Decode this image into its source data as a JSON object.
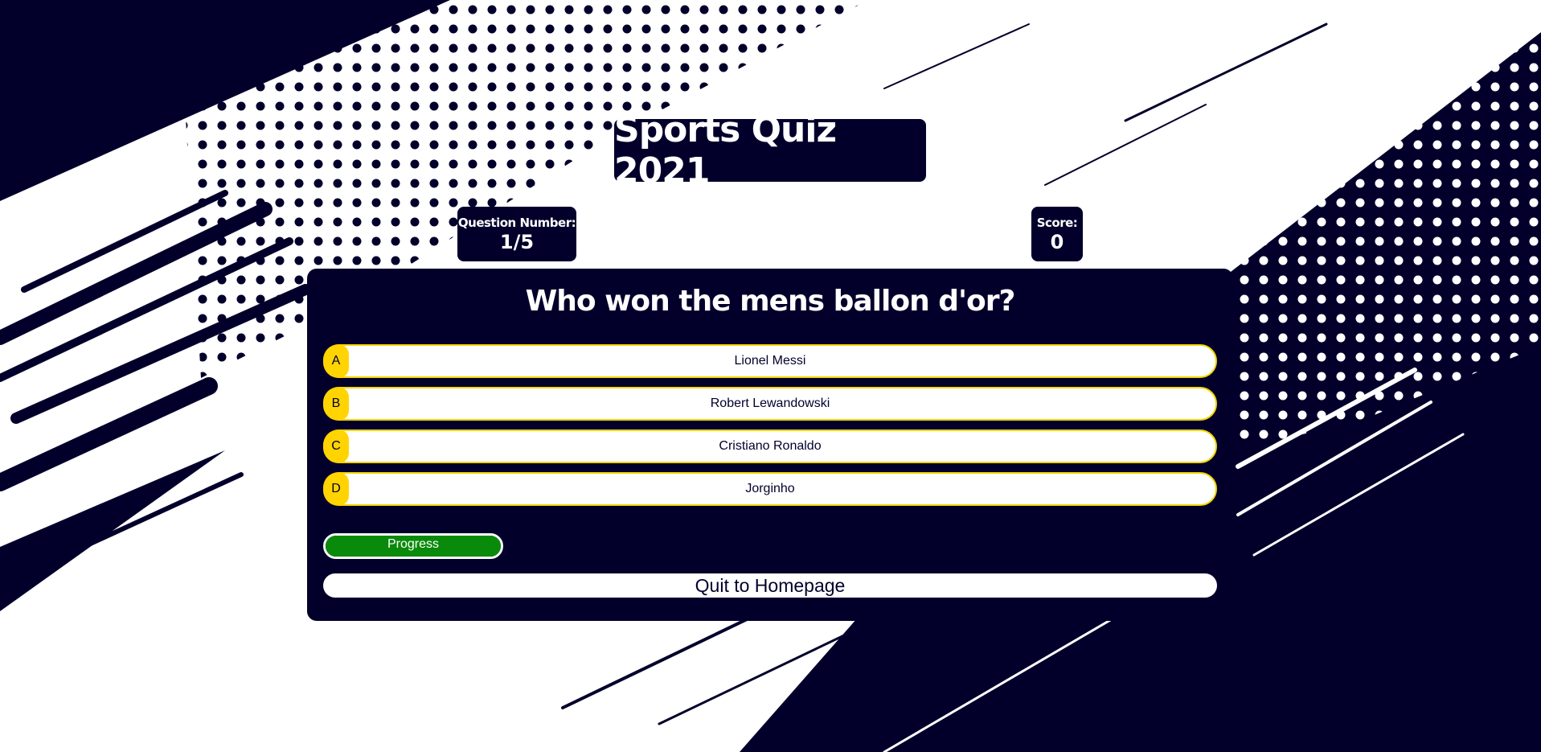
{
  "header": {
    "title": "Sports Quiz 2021"
  },
  "stats": {
    "question_label": "Question Number:",
    "question_value": "1/5",
    "score_label": "Score:",
    "score_value": "0"
  },
  "quiz": {
    "question": "Who won the mens ballon d'or?",
    "answers": [
      {
        "letter": "A",
        "text": "Lionel Messi"
      },
      {
        "letter": "B",
        "text": "Robert Lewandowski"
      },
      {
        "letter": "C",
        "text": "Cristiano Ronaldo"
      },
      {
        "letter": "D",
        "text": "Jorginho"
      }
    ],
    "progress_label": "Progress",
    "progress_fraction": 1.0,
    "quit_label": "Quit to Homepage"
  },
  "colors": {
    "navy": "#02002b",
    "answer_accent": "#ffd400",
    "progress_green": "#0a8a0a"
  }
}
